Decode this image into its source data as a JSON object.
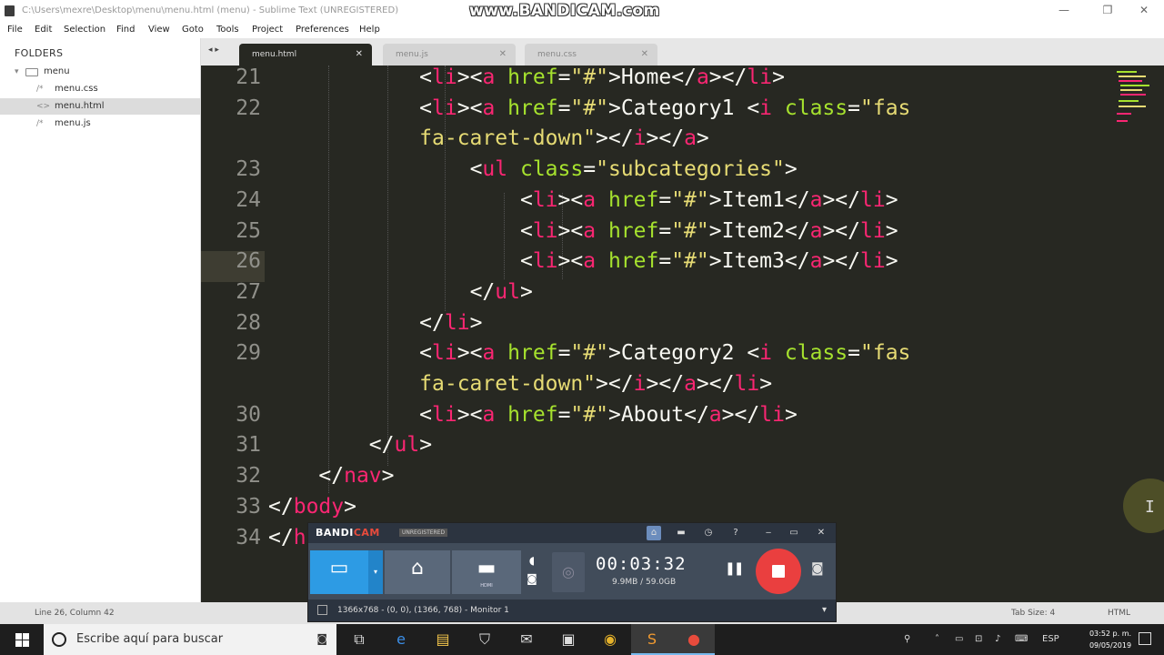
{
  "window": {
    "title": "C:\\Users\\mexre\\Desktop\\menu\\menu.html (menu) - Sublime Text (UNREGISTERED)",
    "watermark": "www.BANDICAM.com",
    "controls": [
      "—",
      "❐",
      "✕"
    ]
  },
  "menubar": [
    "File",
    "Edit",
    "Selection",
    "Find",
    "View",
    "Goto",
    "Tools",
    "Project",
    "Preferences",
    "Help"
  ],
  "sidebar": {
    "header": "FOLDERS",
    "folder": "menu",
    "files": [
      {
        "icon": "/*",
        "name": "menu.css"
      },
      {
        "icon": "<>",
        "name": "menu.html"
      },
      {
        "icon": "/*",
        "name": "menu.js"
      }
    ]
  },
  "tabs": [
    {
      "label": "menu.html",
      "close": "✕"
    },
    {
      "label": "menu.js",
      "close": "✕"
    },
    {
      "label": "menu.css",
      "close": "✕"
    }
  ],
  "editor": {
    "line_numbers": [
      "21",
      "22",
      "",
      "23",
      "24",
      "25",
      "26",
      "27",
      "28",
      "29",
      "",
      "30",
      "31",
      "32",
      "33",
      "34"
    ],
    "current_line": "26",
    "lines": [
      "            <li><a href=\"#\">Home</a></li>",
      "            <li><a href=\"#\">Category1 <i class=\"fas",
      "            fa-caret-down\"></i></a>",
      "                <ul class=\"subcategories\">",
      "                    <li><a href=\"#\">Item1</a></li>",
      "                    <li><a href=\"#\">Item2</a></li>",
      "                    <li><a href=\"#\">Item3</a></li>",
      "                </ul>",
      "            </li>",
      "            <li><a href=\"#\">Category2 <i class=\"fas",
      "            fa-caret-down\"></i></a></li>",
      "            <li><a href=\"#\">About</a></li>",
      "        </ul>",
      "    </nav>",
      "</body>",
      "</h"
    ]
  },
  "statusbar": {
    "position": "Line 26, Column 42",
    "tab_size": "Tab Size: 4",
    "syntax": "HTML"
  },
  "bandicam": {
    "logo_a": "BANDI",
    "logo_b": "CAM",
    "unregistered": "UNREGISTERED",
    "mode_captions": [
      "",
      "",
      "HDMI"
    ],
    "time": "00:03:32",
    "size": "9.9MB / 59.0GB",
    "resolution": "1366x768 - (0, 0), (1366, 768) - Monitor 1",
    "header_icons": [
      "home-icon",
      "folder-icon",
      "clock-icon",
      "help-icon",
      "minimize-icon",
      "compact-icon",
      "close-icon"
    ],
    "header_glyphs": [
      "⌂",
      "▬",
      "◷",
      "?",
      "‒",
      "▭",
      "✕"
    ]
  },
  "taskbar": {
    "search_placeholder": "Escribe aquí para buscar",
    "language": "ESP",
    "time": "03:52 p. m.",
    "date": "09/05/2019",
    "pinned": [
      "task-view-icon",
      "edge-icon",
      "file-explorer-icon",
      "store-icon",
      "mail-icon",
      "terminal-icon",
      "chrome-icon",
      "sublime-icon",
      "bandicam-icon"
    ],
    "pinned_glyphs": [
      "⧉",
      "e",
      "▤",
      "⛉",
      "✉",
      "▣",
      "◉",
      "S",
      "●"
    ],
    "tray_glyphs": [
      "⚲",
      "˄",
      "▭",
      "⊡",
      "♪",
      "⌨"
    ]
  }
}
